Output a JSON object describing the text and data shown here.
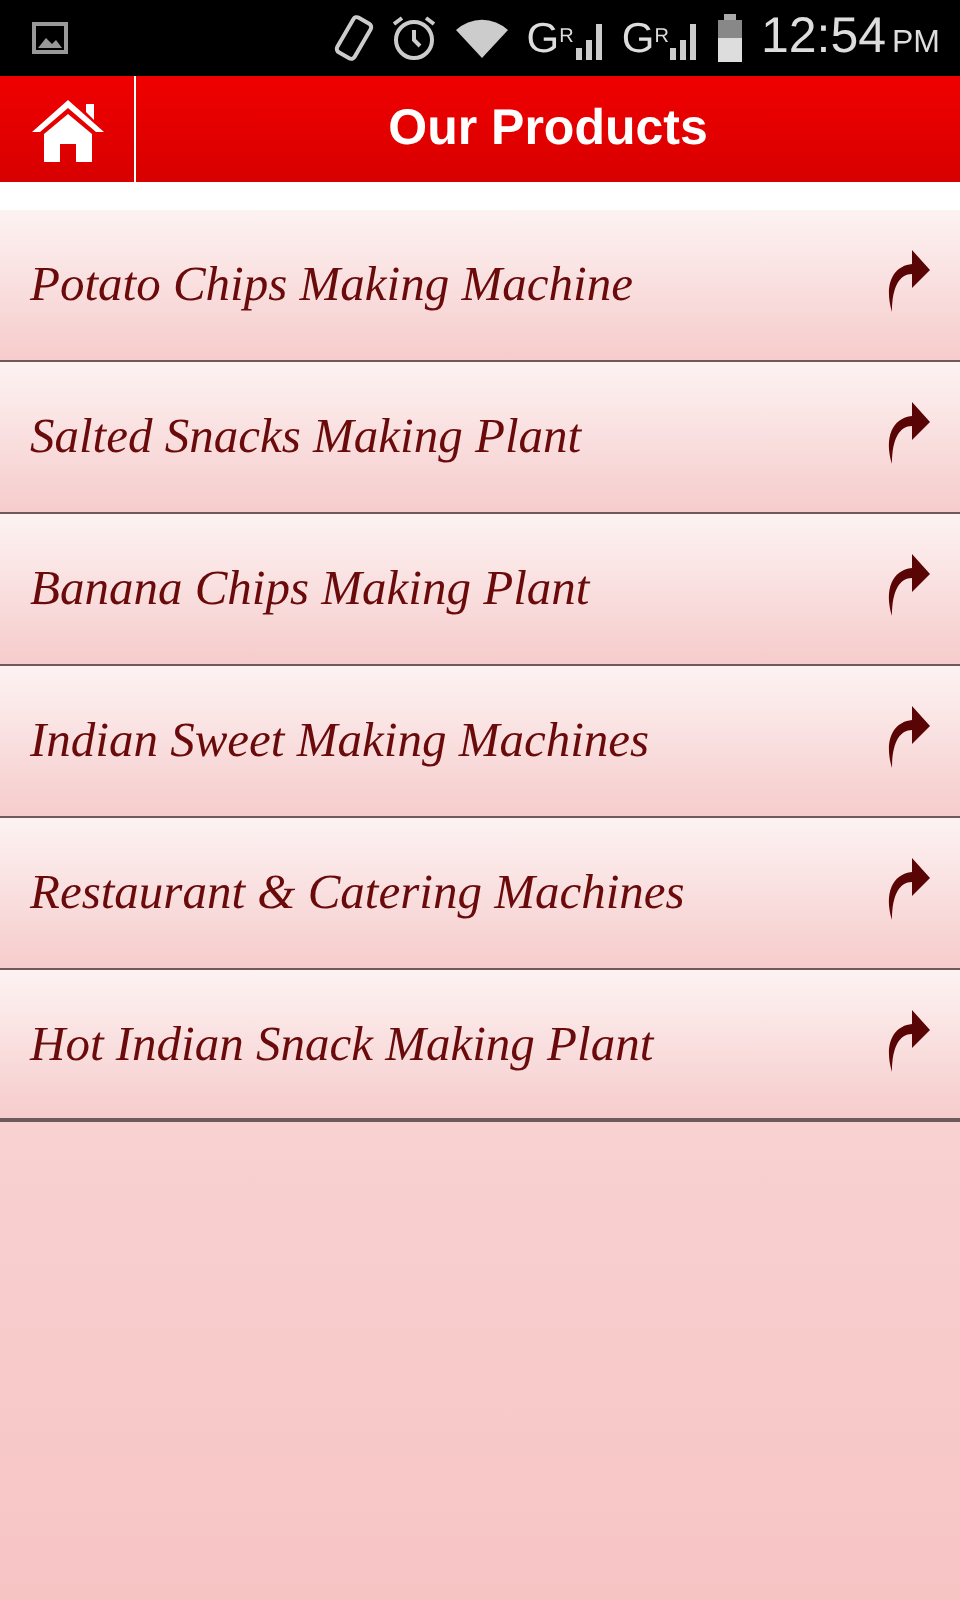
{
  "status_bar": {
    "networks": [
      "G$^{R}$",
      "G$^{R}$"
    ],
    "time": "12:54",
    "meridiem": "PM"
  },
  "header": {
    "title": "Our Products"
  },
  "products": [
    {
      "label": "Potato Chips Making Machine"
    },
    {
      "label": "Salted Snacks Making Plant"
    },
    {
      "label": "Banana Chips Making Plant"
    },
    {
      "label": "Indian Sweet Making Machines"
    },
    {
      "label": "Restaurant & Catering Machines"
    },
    {
      "label": "Hot Indian Snack Making Plant"
    }
  ]
}
